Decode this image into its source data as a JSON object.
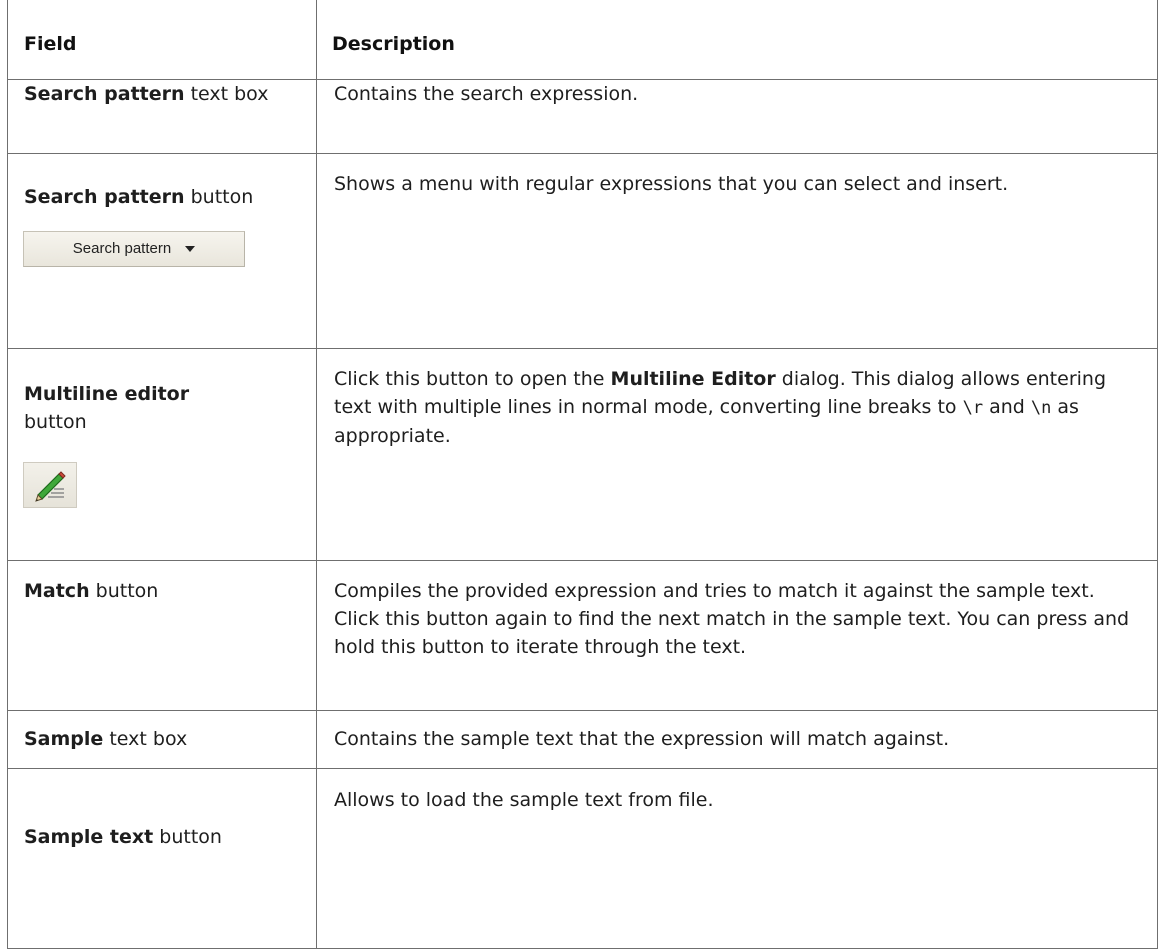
{
  "table": {
    "headers": {
      "field": "Field",
      "description": "Description"
    },
    "rows": [
      {
        "field_bold": "Search pattern",
        "field_rest": " text box",
        "description": "Contains the search expression."
      },
      {
        "field_bold": "Search pattern",
        "field_rest": " button",
        "description": "Shows a menu with regular expressions that you can select and insert.",
        "control_label": "Search pattern",
        "control_icon": "dropdown-arrow-icon"
      },
      {
        "field_bold": "Multiline editor",
        "field_rest": "button",
        "desc_pre": "Click this button to open the ",
        "desc_bold": "Multiline Editor",
        "desc_mid": " dialog. This dialog allows entering text with multiple lines in normal mode, converting line breaks to ",
        "code_r": "\\r",
        "desc_and": " and ",
        "code_n": "\\n",
        "desc_post": " as appropriate.",
        "control_icon": "pencil-icon"
      },
      {
        "field_bold": "Match",
        "field_rest": " button",
        "description": "Compiles the provided expression and tries to match it against the sample text. Click this button again to find the next match in the sample text. You can press and hold this button to iterate through the text."
      },
      {
        "field_bold": "Sample",
        "field_rest": " text box",
        "description": "Contains the sample text that the expression will match against."
      },
      {
        "field_bold": "Sample text",
        "field_rest": " button",
        "description": "Allows to load the sample text from file."
      }
    ]
  },
  "colors": {
    "border": "#6f6f6f",
    "text": "#1e1e1e",
    "pencil_green": "#3fa83a"
  }
}
